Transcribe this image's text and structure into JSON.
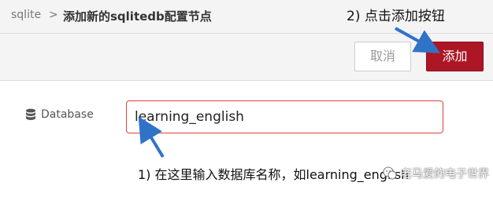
{
  "breadcrumb": {
    "parent": "sqlite",
    "separator": ">",
    "title": "添加新的sqlitedb配置节点"
  },
  "toolbar": {
    "cancel_label": "取消",
    "add_label": "添加"
  },
  "form": {
    "database_label": "Database",
    "database_value": "learning_english",
    "database_icon": "database-icon"
  },
  "annotations": {
    "top_note": "2) 点击添加按钮",
    "bottom_note": "1) 在这里输入数据库名称，如learning_english",
    "arrow_color": "#2f73c9"
  },
  "watermark": {
    "text": "老马爱的电子世界"
  },
  "colors": {
    "accent": "#ad1625",
    "input_border": "#d6453d"
  }
}
